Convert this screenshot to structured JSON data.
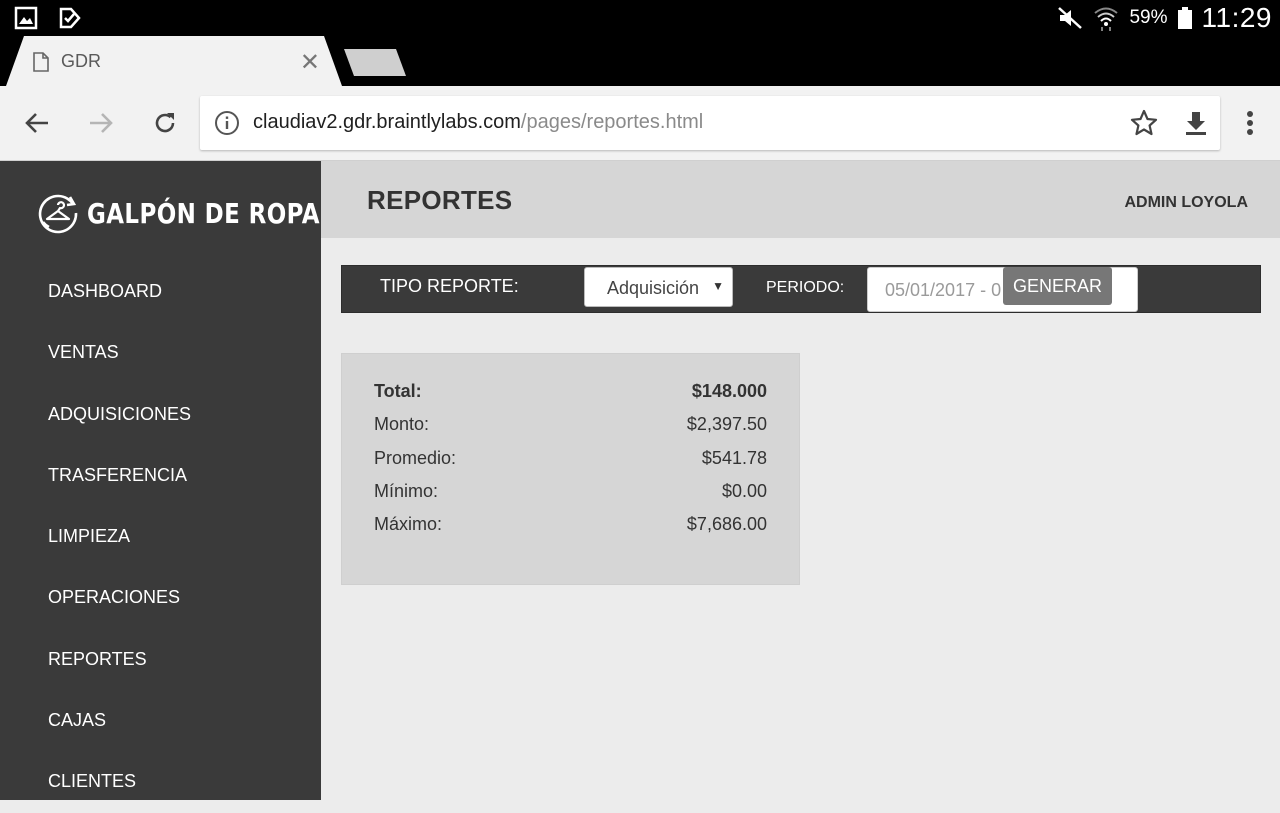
{
  "status_bar": {
    "battery": "59%",
    "time": "11:29"
  },
  "browser": {
    "tab_title": "GDR",
    "url_domain": "claudiav2.gdr.braintlylabs.com",
    "url_path": "/pages/reportes.html"
  },
  "sidebar": {
    "brand": "GALPÓN DE ROPA",
    "items": [
      {
        "label": "DASHBOARD"
      },
      {
        "label": "VENTAS"
      },
      {
        "label": "ADQUISICIONES"
      },
      {
        "label": "TRASFERENCIA"
      },
      {
        "label": "LIMPIEZA"
      },
      {
        "label": "OPERACIONES"
      },
      {
        "label": "REPORTES"
      },
      {
        "label": "CAJAS"
      },
      {
        "label": "CLIENTES"
      }
    ]
  },
  "header": {
    "title": "REPORTES",
    "user": "ADMIN LOYOLA"
  },
  "filters": {
    "tipo_label": "TIPO REPORTE:",
    "tipo_value": "Adquisición",
    "periodo_label": "PERIODO:",
    "periodo_value": "05/01/2017 - 0",
    "generate_label": "GENERAR"
  },
  "summary": {
    "rows": [
      {
        "label": "Total:",
        "value": "$148.000"
      },
      {
        "label": "Monto:",
        "value": "$2,397.50"
      },
      {
        "label": "Promedio:",
        "value": "$541.78"
      },
      {
        "label": "Mínimo:",
        "value": "$0.00"
      },
      {
        "label": "Máximo:",
        "value": "$7,686.00"
      }
    ]
  }
}
